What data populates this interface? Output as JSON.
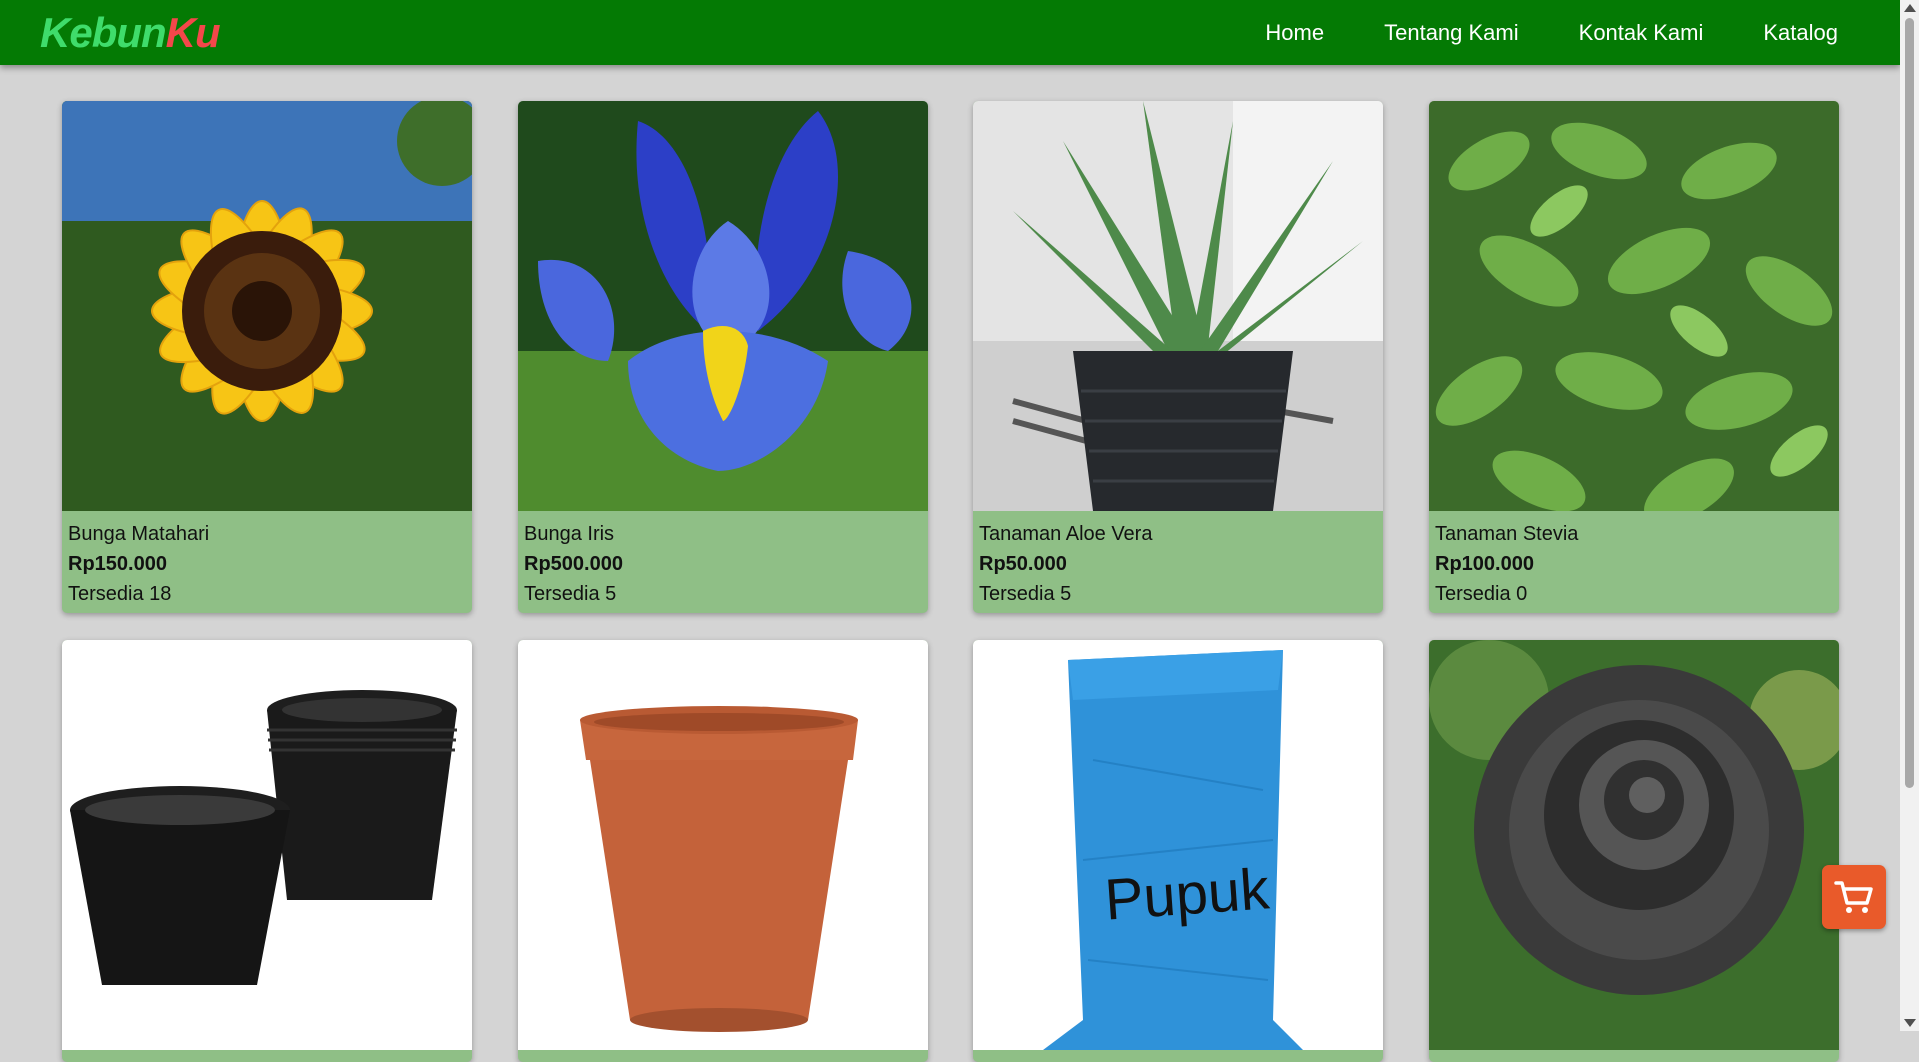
{
  "brand": {
    "part1": "Kebun",
    "part2": "Ku",
    "color1": "#3fdc6b",
    "color2": "#f4474a"
  },
  "nav": {
    "items": [
      "Home",
      "Tentang Kami",
      "Kontak Kami",
      "Katalog"
    ]
  },
  "products": [
    {
      "name": "Bunga Matahari",
      "price": "Rp150.000",
      "stock": "Tersedia 18",
      "image": "sunflower"
    },
    {
      "name": "Bunga Iris",
      "price": "Rp500.000",
      "stock": "Tersedia 5",
      "image": "iris"
    },
    {
      "name": "Tanaman Aloe Vera",
      "price": "Rp50.000",
      "stock": "Tersedia 5",
      "image": "aloe-vera"
    },
    {
      "name": "Tanaman Stevia",
      "price": "Rp100.000",
      "stock": "Tersedia 0",
      "image": "stevia"
    },
    {
      "image": "black-plastic-pots"
    },
    {
      "image": "terracotta-pot"
    },
    {
      "image": "fertilizer-sack",
      "label": "Pupuk"
    },
    {
      "image": "black-rose"
    }
  ],
  "cart": {
    "icon": "cart-icon",
    "color": "#e95a2a"
  },
  "colors": {
    "navbar": "#047a04",
    "card": "#8fbf86",
    "background": "#d4d4d4"
  }
}
